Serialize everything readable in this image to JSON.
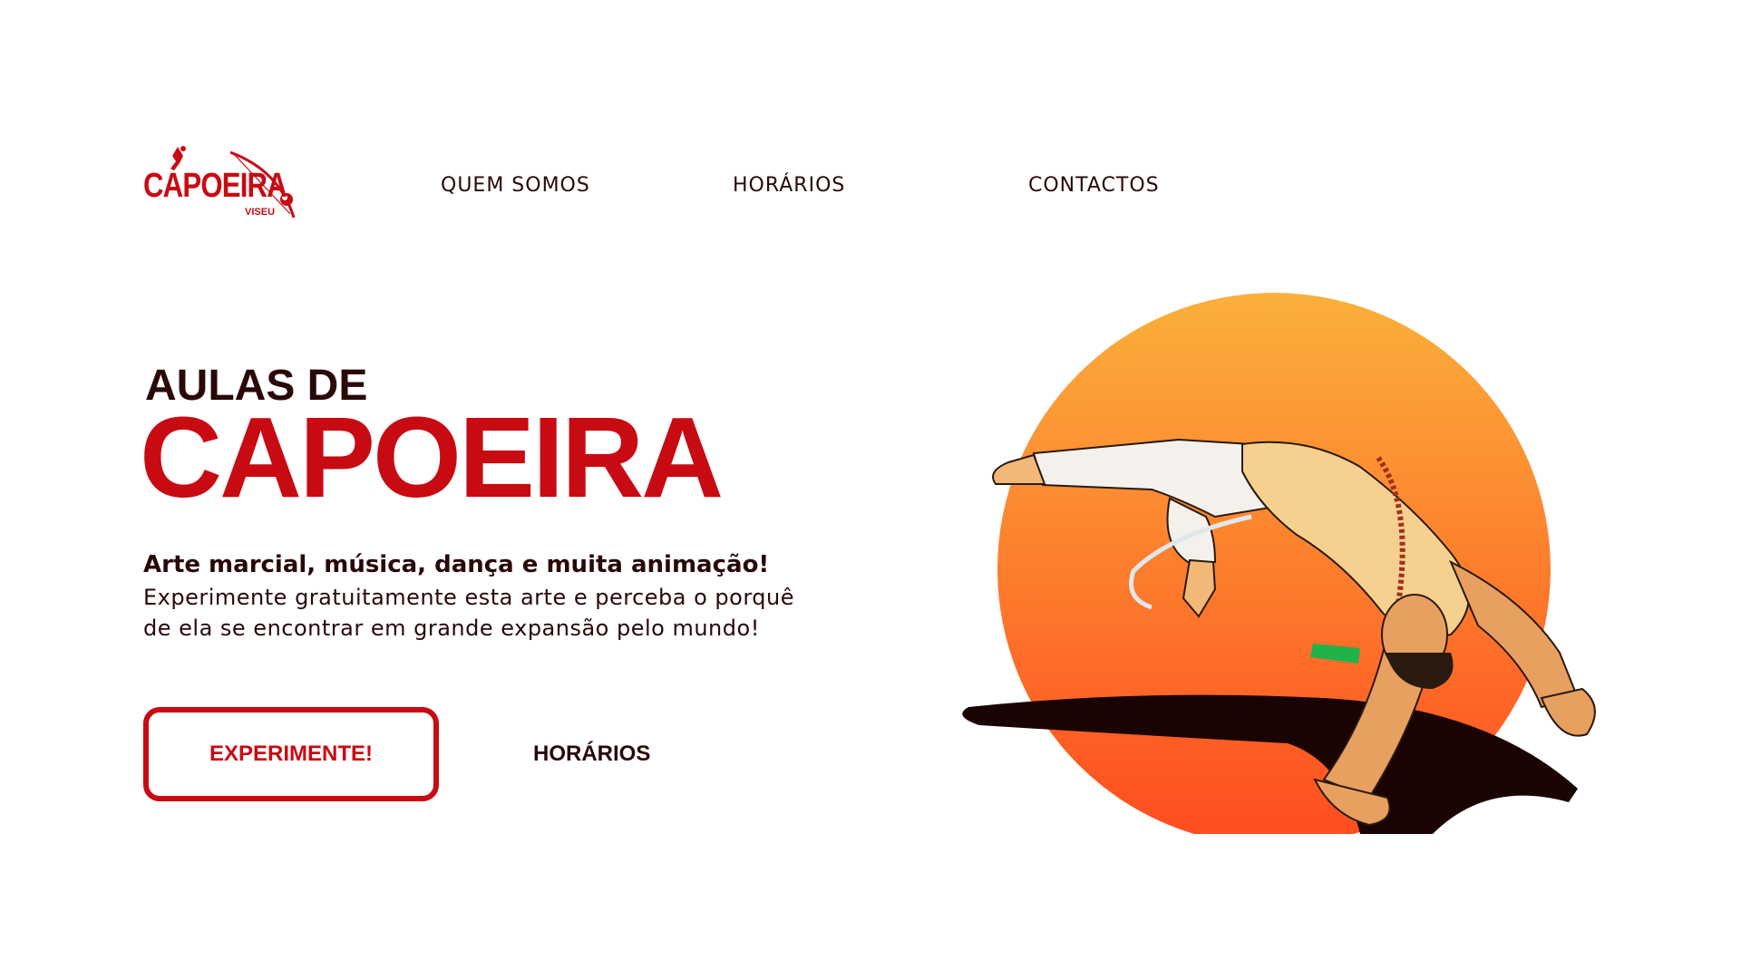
{
  "logo": {
    "main_text": "CAPOEIRA",
    "sub_text": "VISEU",
    "color": "#c80a13"
  },
  "nav": {
    "items": [
      {
        "label": "QUEM SOMOS"
      },
      {
        "label": "HORÁRIOS"
      },
      {
        "label": "CONTACTOS"
      }
    ]
  },
  "hero": {
    "kicker": "AULAS DE",
    "title": "CAPOEIRA",
    "lead": "Arte marcial, música, dança e muita animação!",
    "description_line1": "Experimente gratuitamente esta arte e perceba o porquê",
    "description_line2": "de ela se encontrar em grande expansão pelo mundo!",
    "primary_button": "EXPERIMENTE!",
    "secondary_button": "HORÁRIOS"
  },
  "illustration": {
    "subject": "capoeirista-doing-au-sem-mao",
    "sun_colors": [
      "#fbb03b",
      "#ff4b1f"
    ],
    "shadow_color": "#1a0303"
  },
  "colors": {
    "brand_red": "#c80a13",
    "dark_text": "#2a0808",
    "background": "#ffffff"
  }
}
